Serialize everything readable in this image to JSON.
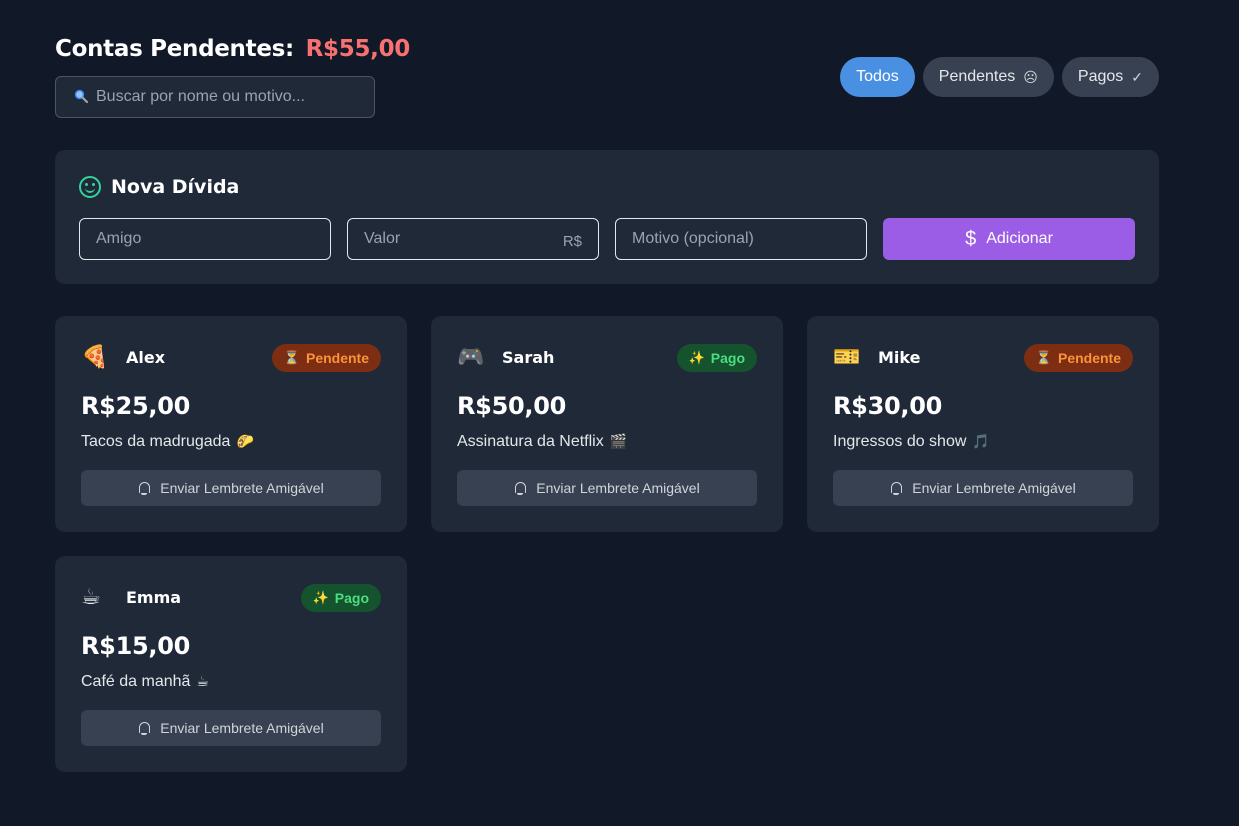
{
  "header": {
    "title": "Contas Pendentes:",
    "total": "R$55,00"
  },
  "search": {
    "icon": "search-icon",
    "placeholder": "Buscar por nome ou motivo..."
  },
  "filters": [
    {
      "label": "Todos",
      "icon": "",
      "active": true
    },
    {
      "label": "Pendentes",
      "icon": "☹",
      "active": false
    },
    {
      "label": "Pagos",
      "icon": "✓",
      "active": false
    }
  ],
  "form": {
    "title": "Nova Dívida",
    "friend_placeholder": "Amigo",
    "value_placeholder": "Valor",
    "value_suffix": "R$",
    "reason_placeholder": "Motivo (opcional)",
    "submit_icon": "$",
    "submit_label": "Adicionar"
  },
  "colors": {
    "background": "#111827",
    "panel": "#1f2937",
    "accent_blue": "#4a90e2",
    "accent_purple": "#9b5de5",
    "total_red": "#f87171",
    "pending": "#fb923c",
    "paid": "#4ade80"
  },
  "debts": [
    {
      "emoji": "🍕",
      "name": "Alex",
      "status": "Pendente",
      "status_icon": "⏳",
      "status_type": "pending",
      "amount": "R$25,00",
      "reason": "Tacos da madrugada",
      "reason_emoji": "🌮",
      "remind_label": "Enviar Lembrete Amigável"
    },
    {
      "emoji": "🎮",
      "name": "Sarah",
      "status": "Pago",
      "status_icon": "✨",
      "status_type": "paid",
      "amount": "R$50,00",
      "reason": "Assinatura da Netflix",
      "reason_emoji": "🎬",
      "remind_label": "Enviar Lembrete Amigável"
    },
    {
      "emoji": "🎫",
      "name": "Mike",
      "status": "Pendente",
      "status_icon": "⏳",
      "status_type": "pending",
      "amount": "R$30,00",
      "reason": "Ingressos do show",
      "reason_emoji": "🎵",
      "remind_label": "Enviar Lembrete Amigável"
    },
    {
      "emoji": "☕",
      "name": "Emma",
      "status": "Pago",
      "status_icon": "✨",
      "status_type": "paid",
      "amount": "R$15,00",
      "reason": "Café da manhã",
      "reason_emoji": "☕",
      "remind_label": "Enviar Lembrete Amigável"
    }
  ]
}
